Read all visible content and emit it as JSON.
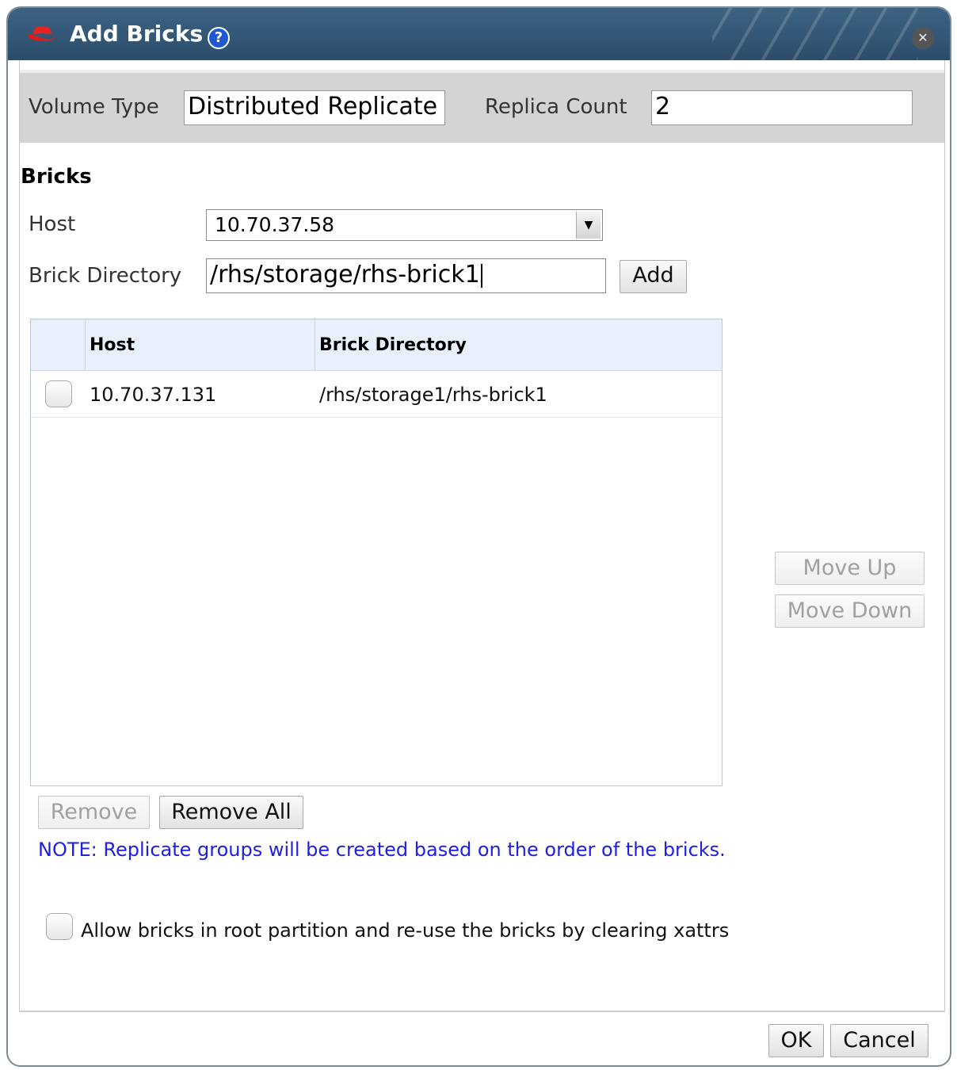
{
  "dialog": {
    "title": "Add Bricks",
    "help_icon": "question-circle-icon",
    "close_icon": "close-circle-icon",
    "logo_icon": "redhat-shadowman-icon"
  },
  "volume": {
    "type_label": "Volume Type",
    "type_value": "Distributed Replicate",
    "replica_label": "Replica Count",
    "replica_value": "2"
  },
  "bricks": {
    "section_title": "Bricks",
    "host_label": "Host",
    "host_selected": "10.70.37.58",
    "dir_label": "Brick Directory",
    "dir_value": "/rhs/storage/rhs-brick1",
    "add_label": "Add"
  },
  "table": {
    "columns": [
      "Host",
      "Brick Directory"
    ],
    "rows": [
      {
        "host": "10.70.37.131",
        "dir": "/rhs/storage1/rhs-brick1"
      }
    ]
  },
  "side_buttons": {
    "move_up": "Move Up",
    "move_down": "Move Down"
  },
  "actions": {
    "remove": "Remove",
    "remove_all": "Remove All"
  },
  "note": "NOTE: Replicate groups will be created based on the order of the bricks.",
  "allow_root": "Allow bricks in root partition and re-use the bricks by clearing xattrs",
  "footer": {
    "ok": "OK",
    "cancel": "Cancel"
  },
  "colors": {
    "titlebar": "#2b4d6b",
    "note": "#2020dd",
    "header_band": "#d4d4d4",
    "grid_header": "#eaf0fb"
  }
}
